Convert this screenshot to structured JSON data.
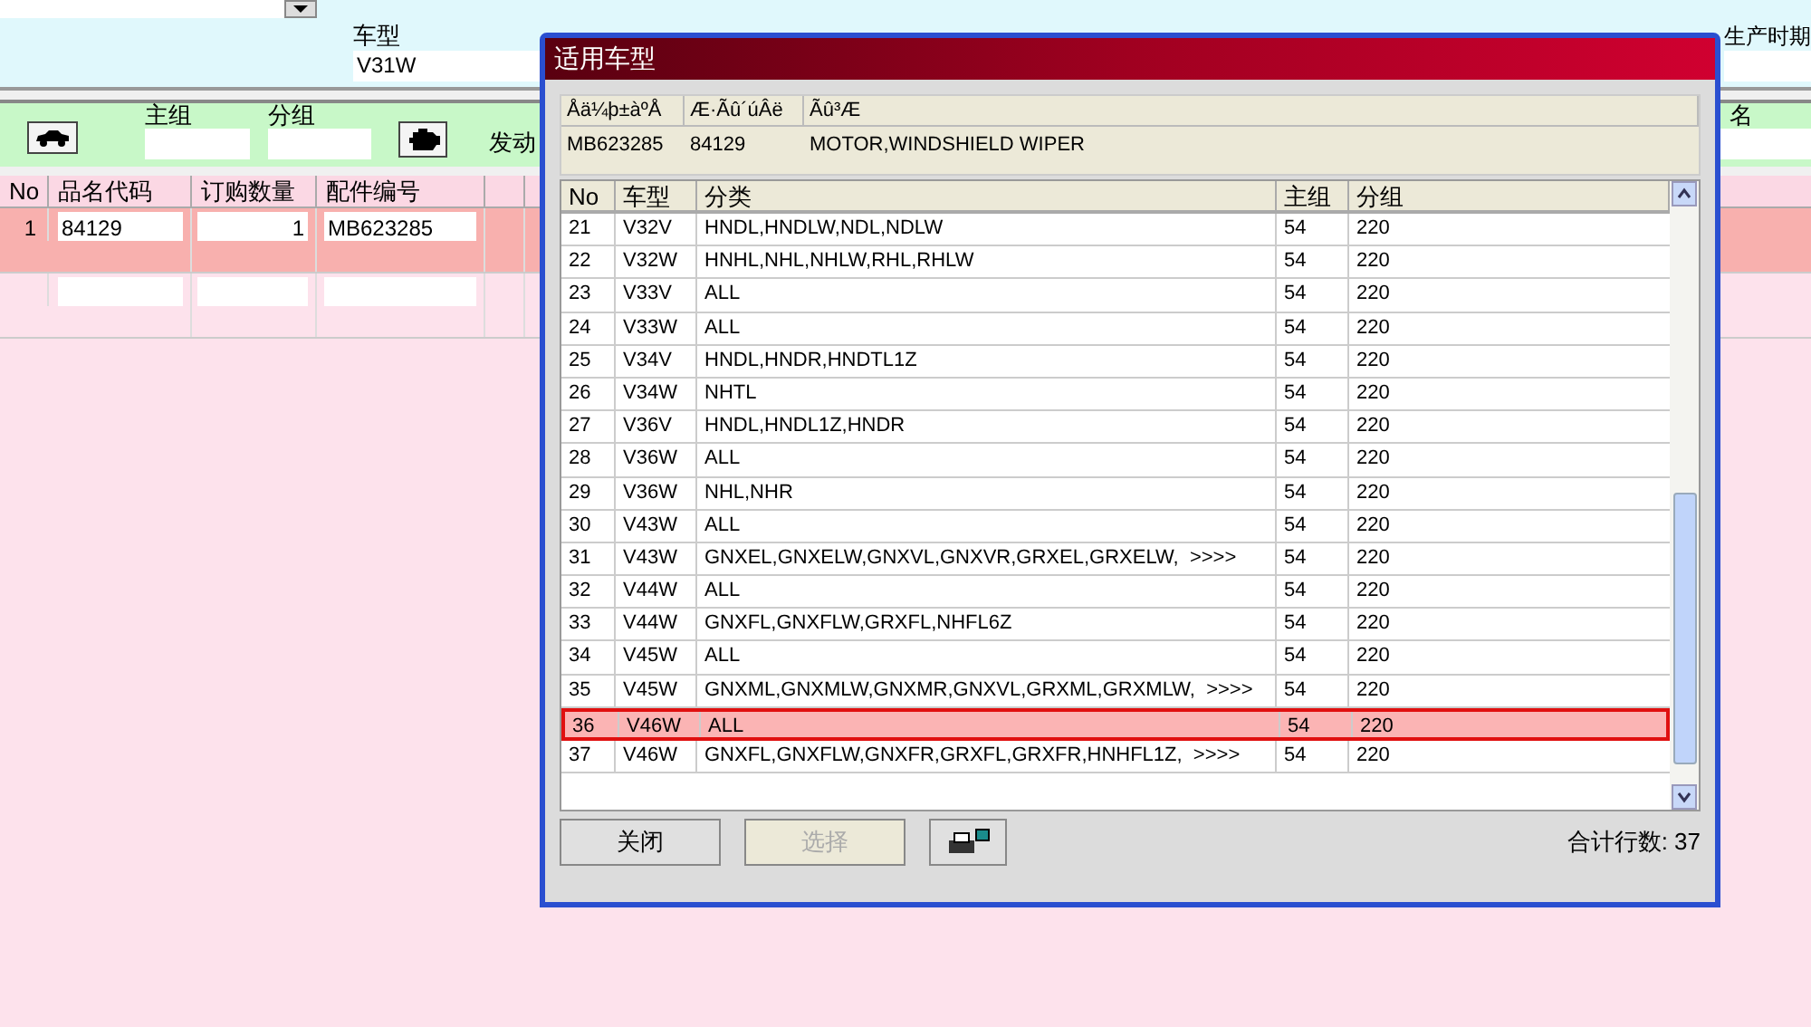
{
  "top": {
    "model_label": "车型",
    "model_value": "V31W",
    "period_label": "生产时期"
  },
  "filter": {
    "main_group_label": "主组",
    "sub_group_label": "分组",
    "engine_label": "发动",
    "name_label": "名"
  },
  "order_table": {
    "columns": [
      "No",
      "品名代码",
      "订购数量",
      "配件编号"
    ],
    "rows": [
      {
        "no": "1",
        "code": "84129",
        "qty": "1",
        "part": "MB623285",
        "selected": true
      },
      {
        "no": "",
        "code": "",
        "qty": "",
        "part": "",
        "selected": false
      }
    ]
  },
  "dialog": {
    "title": "适用车型",
    "info_columns": [
      "Åä¼þ±àºÅ",
      "Æ·Ãû´úÂë",
      "Ãû³Æ"
    ],
    "info_values": [
      "MB623285",
      "84129",
      "MOTOR,WINDSHIELD WIPER"
    ],
    "columns": [
      "No",
      "车型",
      "分类",
      "主组",
      "分组"
    ],
    "rows": [
      {
        "no": "21",
        "model": "V32V",
        "category": "HNDL,HNDLW,NDL,NDLW",
        "main": "54",
        "sub": "220",
        "selected": false
      },
      {
        "no": "22",
        "model": "V32W",
        "category": "HNHL,NHL,NHLW,RHL,RHLW",
        "main": "54",
        "sub": "220",
        "selected": false
      },
      {
        "no": "23",
        "model": "V33V",
        "category": "ALL",
        "main": "54",
        "sub": "220",
        "selected": false
      },
      {
        "no": "24",
        "model": "V33W",
        "category": "ALL",
        "main": "54",
        "sub": "220",
        "selected": false
      },
      {
        "no": "25",
        "model": "V34V",
        "category": "HNDL,HNDR,HNDTL1Z",
        "main": "54",
        "sub": "220",
        "selected": false
      },
      {
        "no": "26",
        "model": "V34W",
        "category": "NHTL",
        "main": "54",
        "sub": "220",
        "selected": false
      },
      {
        "no": "27",
        "model": "V36V",
        "category": "HNDL,HNDL1Z,HNDR",
        "main": "54",
        "sub": "220",
        "selected": false
      },
      {
        "no": "28",
        "model": "V36W",
        "category": "ALL",
        "main": "54",
        "sub": "220",
        "selected": false
      },
      {
        "no": "29",
        "model": "V36W",
        "category": "NHL,NHR",
        "main": "54",
        "sub": "220",
        "selected": false
      },
      {
        "no": "30",
        "model": "V43W",
        "category": "ALL",
        "main": "54",
        "sub": "220",
        "selected": false
      },
      {
        "no": "31",
        "model": "V43W",
        "category": "GNXEL,GNXELW,GNXVL,GNXVR,GRXEL,GRXELW,  >>>>",
        "main": "54",
        "sub": "220",
        "selected": false
      },
      {
        "no": "32",
        "model": "V44W",
        "category": "ALL",
        "main": "54",
        "sub": "220",
        "selected": false
      },
      {
        "no": "33",
        "model": "V44W",
        "category": "GNXFL,GNXFLW,GRXFL,NHFL6Z",
        "main": "54",
        "sub": "220",
        "selected": false
      },
      {
        "no": "34",
        "model": "V45W",
        "category": "ALL",
        "main": "54",
        "sub": "220",
        "selected": false
      },
      {
        "no": "35",
        "model": "V45W",
        "category": "GNXML,GNXMLW,GNXMR,GNXVL,GRXML,GRXMLW,  >>>>",
        "main": "54",
        "sub": "220",
        "selected": false
      },
      {
        "no": "36",
        "model": "V46W",
        "category": "ALL",
        "main": "54",
        "sub": "220",
        "selected": true
      },
      {
        "no": "37",
        "model": "V46W",
        "category": "GNXFL,GNXFLW,GNXFR,GRXFL,GRXFR,HNHFL1Z,  >>>>",
        "main": "54",
        "sub": "220",
        "selected": false
      }
    ],
    "buttons": [
      {
        "label": "关闭",
        "disabled": false
      },
      {
        "label": "选择",
        "disabled": true
      }
    ],
    "total": "合计行数: 37"
  }
}
